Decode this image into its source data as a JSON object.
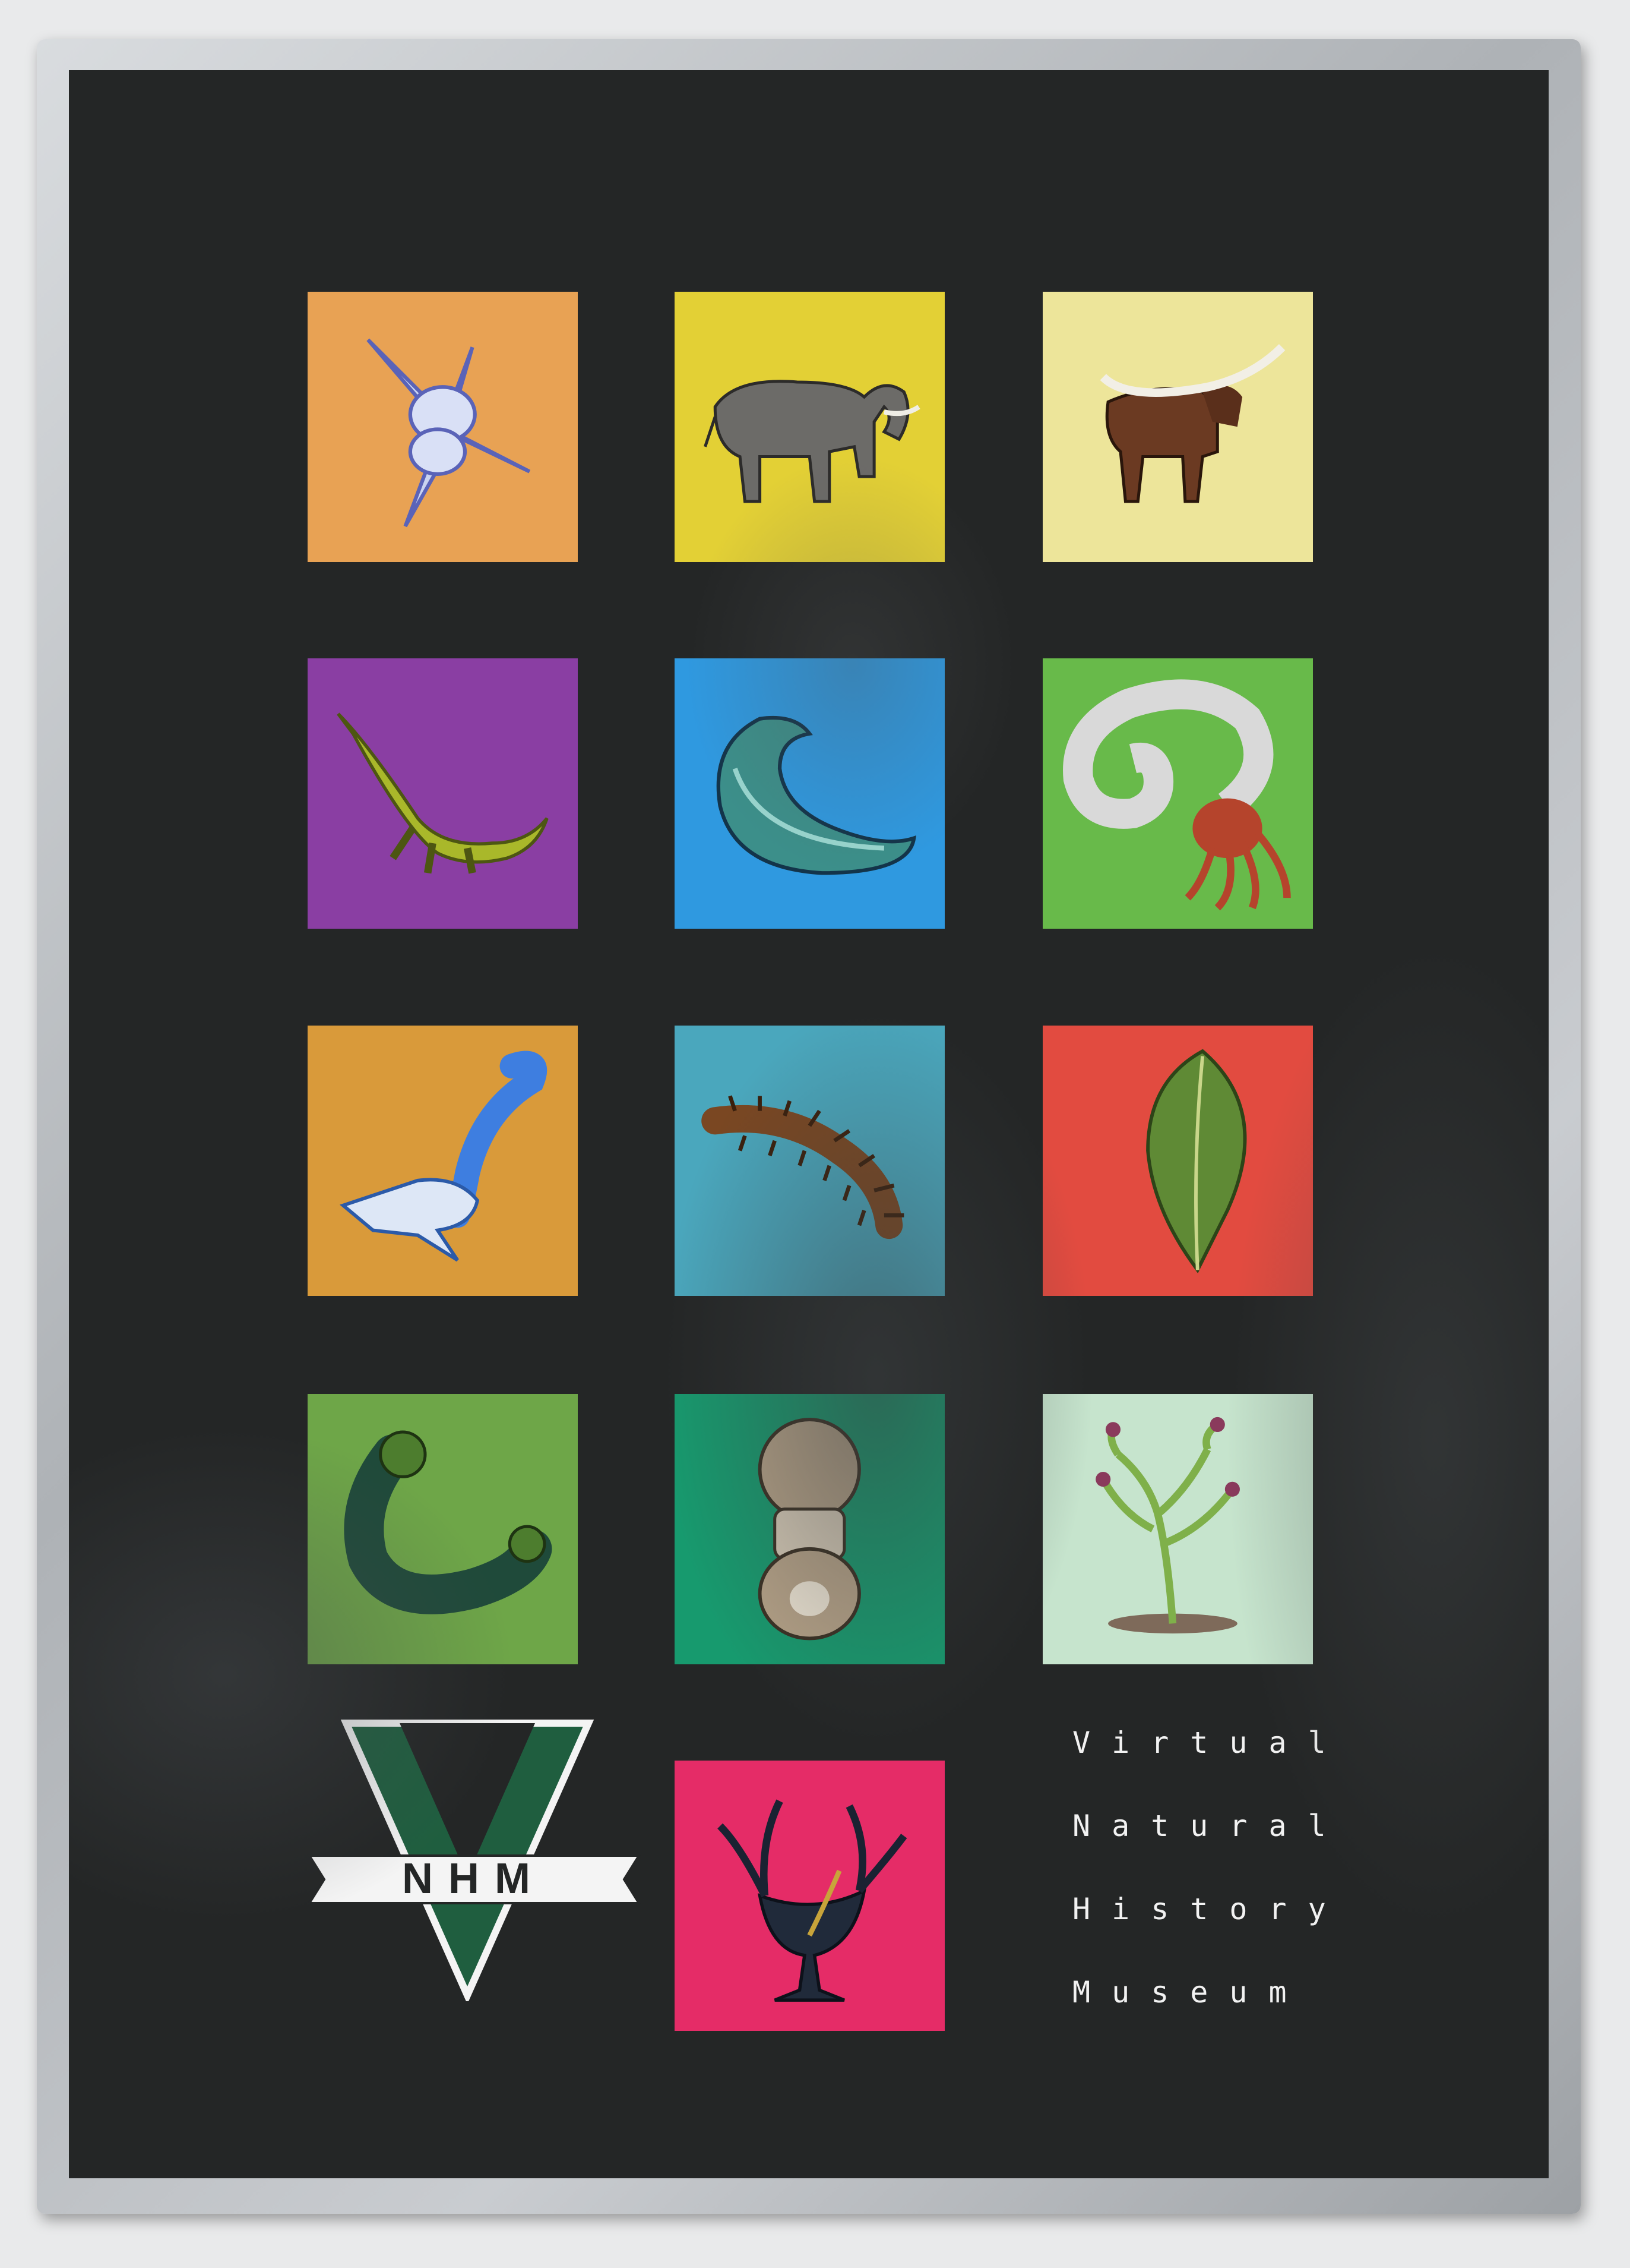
{
  "poster": {
    "title_lines": [
      "Virtual",
      "Natural",
      "History",
      "Museum"
    ],
    "logo": {
      "banner_text": "NHM",
      "green": "#1f5e3f",
      "banner_white": "#f4f4f4"
    },
    "tiles": [
      {
        "creature": "sponge-spicule-icon",
        "color": "#e8a254"
      },
      {
        "creature": "elephant-icon",
        "color": "#e3d035"
      },
      {
        "creature": "buffalo-icon",
        "color": "#ede59a"
      },
      {
        "creature": "plesiosaur-icon",
        "color": "#8a3ea3"
      },
      {
        "creature": "ammonite-icon",
        "color": "#2f99e0"
      },
      {
        "creature": "nautiloid-icon",
        "color": "#68ba4a"
      },
      {
        "creature": "worm-creature-icon",
        "color": "#d99a3a"
      },
      {
        "creature": "millipede-icon",
        "color": "#4aa7bd"
      },
      {
        "creature": "leaf-fossil-icon",
        "color": "#e24b40"
      },
      {
        "creature": "velvet-worm-icon",
        "color": "#6ea648"
      },
      {
        "creature": "trilobite-icon",
        "color": "#179a6e"
      },
      {
        "creature": "early-plant-icon",
        "color": "#c6e4cd"
      },
      {
        "creature": "chalice-organism-icon",
        "color": "#e52c67"
      }
    ]
  }
}
